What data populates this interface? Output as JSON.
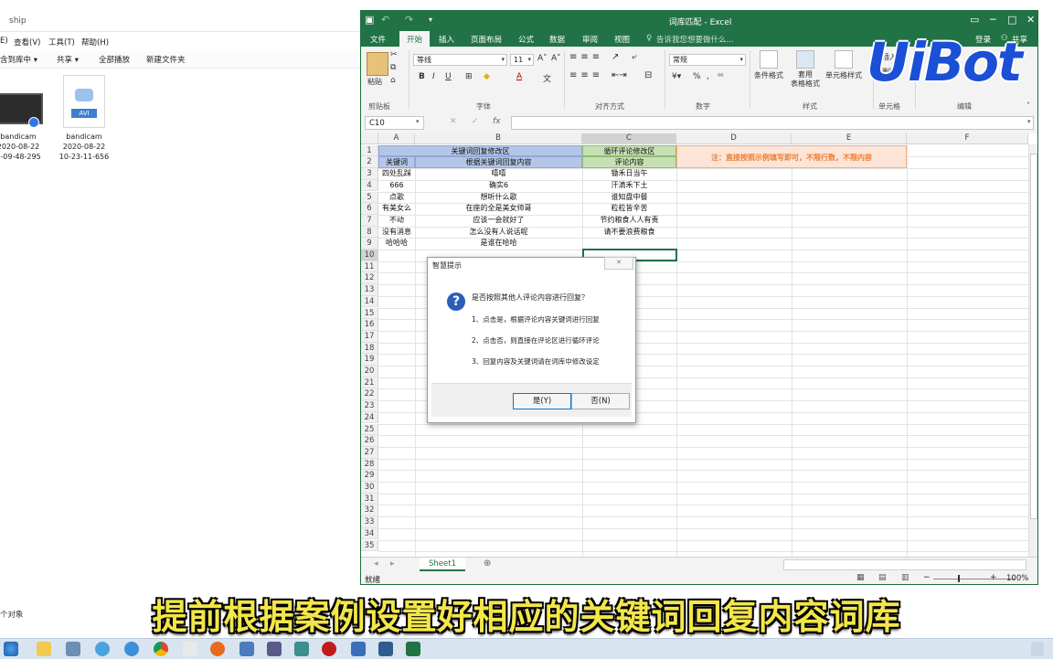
{
  "explorer": {
    "title": "ship",
    "menu": [
      "E)",
      "查看(V)",
      "工具(T)",
      "帮助(H)"
    ],
    "toolbar": [
      "含到库中 ▾",
      "共享 ▾",
      "全部播放",
      "新建文件夹"
    ],
    "files": [
      {
        "name": "bandicam",
        "date": "2020-08-22",
        "time": "0-09-48-295",
        "icon": "video-thumbnail-icon"
      },
      {
        "name": "bandicam",
        "date": "2020-08-22",
        "time": "10-23-11-656",
        "icon": "avi-file-icon",
        "badge": "AVI"
      }
    ],
    "status": "个对象"
  },
  "excel": {
    "title": "词库匹配 - Excel",
    "tabs": [
      "文件",
      "开始",
      "插入",
      "页面布局",
      "公式",
      "数据",
      "审阅",
      "视图"
    ],
    "active_tab": "开始",
    "tell_me": "告诉我您想要做什么...",
    "login": "登录",
    "share": "共享",
    "ribbon": {
      "paste": "粘贴",
      "font_name": "等线",
      "font_size": "11",
      "number_format": "常规",
      "conditional_format": "条件格式",
      "table_format": "套用\n表格格式",
      "cell_style": "单元格样式",
      "insert": "插入",
      "delete": "删除",
      "groups": [
        "剪贴板",
        "字体",
        "对齐方式",
        "数字",
        "样式",
        "单元格",
        "编辑"
      ]
    },
    "name_box": "C10",
    "fx": "fx",
    "columns": [
      "A",
      "B",
      "C",
      "D",
      "E",
      "F"
    ],
    "rows": [
      "1",
      "2",
      "3",
      "4",
      "5",
      "6",
      "7",
      "8",
      "9",
      "10",
      "11",
      "12",
      "13",
      "14",
      "15",
      "16",
      "17",
      "18",
      "19",
      "20",
      "21",
      "22",
      "23",
      "24",
      "25",
      "26",
      "27",
      "28",
      "29",
      "30",
      "31",
      "32",
      "33",
      "34",
      "35"
    ],
    "cells": {
      "b1": "关键词回复修改区",
      "c1": "循环评论修改区",
      "a2": "关键词",
      "b2": "根据关键词回复内容",
      "c2": "评论内容",
      "d1": "注：直接按照示例填写即可，不限行数，不限内容",
      "data": [
        {
          "a": "四处乱踩",
          "b": "嘻嘻",
          "c": "锄禾日当午"
        },
        {
          "a": "666",
          "b": "确实6",
          "c": "汗滴禾下土"
        },
        {
          "a": "点歌",
          "b": "想听什么歌",
          "c": "谁知盘中餐"
        },
        {
          "a": "有美女么",
          "b": "在座的全是美女帅哥",
          "c": "粒粒皆辛苦"
        },
        {
          "a": "不动",
          "b": "应该一会就好了",
          "c": "节约粮食人人有责"
        },
        {
          "a": "没有消息",
          "b": "怎么没有人说话呢",
          "c": "请不要浪费粮食"
        },
        {
          "a": "哈哈哈",
          "b": "是谁在哈哈",
          "c": ""
        }
      ]
    },
    "sheet_tab": "Sheet1",
    "status_ready": "就绪",
    "zoom": "100%"
  },
  "dialog": {
    "title": "智慧提示",
    "question": "是否按照其他人评论内容进行回复？",
    "lines": [
      "1、点击是，根据评论内容关键词进行回复",
      "2、点击否，则直接在评论区进行循环评论",
      "3、回复内容及关键词请在词库中修改设定"
    ],
    "yes": "是(Y)",
    "no": "否(N)"
  },
  "subtitle": "提前根据案例设置好相应的关键词回复内容词库",
  "logo": "UiBot",
  "colors": {
    "excel_green": "#217346",
    "header_blue": "#b4c6e7",
    "header_green": "#c6e0b4",
    "note_orange": "#ed7d31",
    "note_fill": "#fce4d6",
    "subtitle_yellow": "#f2e64a",
    "logo_blue": "#1a4fd6"
  }
}
